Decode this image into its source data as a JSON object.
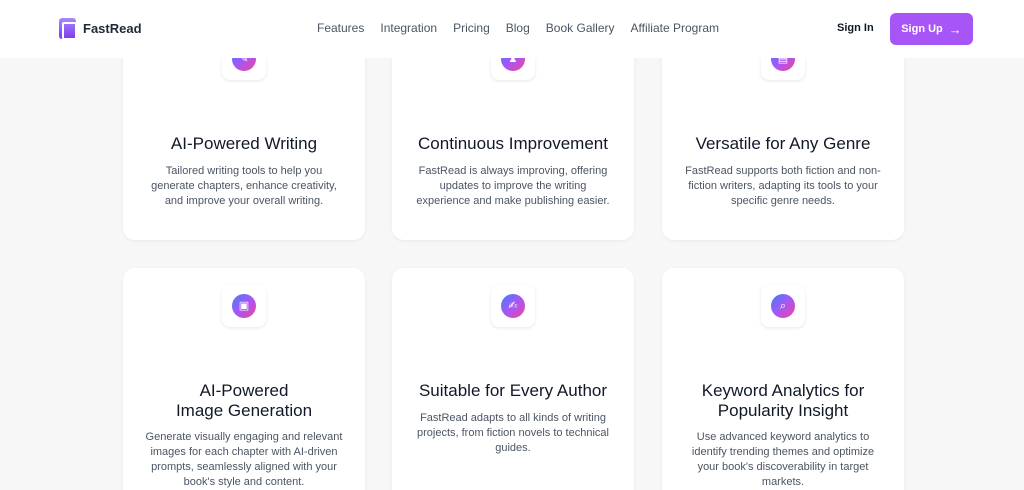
{
  "header": {
    "brand": "FastRead",
    "nav": [
      "Features",
      "Integration",
      "Pricing",
      "Blog",
      "Book Gallery",
      "Affiliate Program"
    ],
    "sign_in": "Sign In",
    "sign_up": "Sign Up",
    "sign_up_arrow": "→"
  },
  "colors": {
    "accent": "#a855f7",
    "icon_gradient": [
      "#3b82f6",
      "#a855f7",
      "#ec4899"
    ]
  },
  "features": [
    {
      "icon": "pen-icon",
      "glyph": "✎",
      "title": "AI-Powered Writing",
      "desc": [
        "Tailored writing tools to help you",
        "generate chapters, enhance creativity,",
        "and improve your overall writing."
      ]
    },
    {
      "icon": "rocket-icon",
      "glyph": "▲",
      "title": "Continuous Improvement",
      "desc": [
        "FastRead is always improving, offering",
        "updates to improve the writing",
        "experience and make publishing easier."
      ]
    },
    {
      "icon": "book-icon",
      "glyph": "▤",
      "title": "Versatile for Any Genre",
      "desc": [
        "FastRead supports both fiction and non-",
        "fiction writers, adapting its tools to your",
        "specific genre needs."
      ]
    },
    {
      "icon": "image-icon",
      "glyph": "▣",
      "title_lines": [
        "AI-Powered",
        "Image Generation"
      ],
      "desc": [
        "Generate visually engaging and relevant",
        "images for each chapter with AI-driven",
        "prompts, seamlessly aligned with your",
        "book's style and content."
      ]
    },
    {
      "icon": "document-icon",
      "glyph": "✍",
      "title": "Suitable for Every Author",
      "desc": [
        "FastRead adapts to all kinds of writing",
        "projects, from fiction novels to technical",
        "guides."
      ]
    },
    {
      "icon": "search-analytics-icon",
      "glyph": "⌕",
      "title_lines": [
        "Keyword Analytics for",
        "Popularity Insight"
      ],
      "desc": [
        "Use advanced keyword analytics to",
        "identify trending themes and optimize",
        "your book's discoverability in target",
        "markets."
      ]
    }
  ]
}
